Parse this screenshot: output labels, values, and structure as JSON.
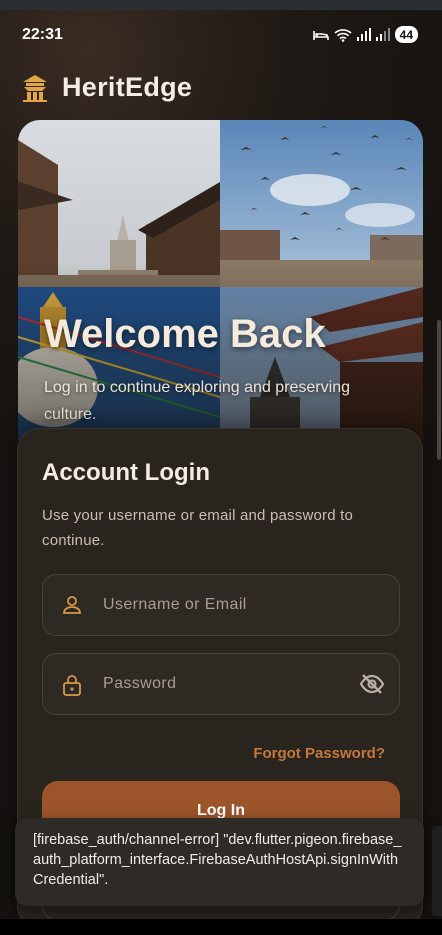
{
  "status_bar": {
    "time": "22:31",
    "battery": "44"
  },
  "brand": {
    "icon": "temple-icon",
    "name": "HeritEdge",
    "accent": "#e0a545"
  },
  "hero": {
    "title": "Welcome Back",
    "subtitle": "Log in to continue exploring and preserving culture."
  },
  "login_card": {
    "title": "Account Login",
    "subtitle": "Use your username or email and password to continue.",
    "username": {
      "placeholder": "Username or Email",
      "value": "",
      "icon": "person-icon"
    },
    "password": {
      "placeholder": "Password",
      "value": "",
      "icon": "lock-icon",
      "toggle_icon": "eye-off-icon"
    },
    "forgot_password_label": "Forgot Password?",
    "login_label": "Log In",
    "primary_color": "#9c552a",
    "link_color": "#c2783f"
  },
  "toast": {
    "message": "[firebase_auth/channel-error] \"dev.flutter.pigeon.firebase_auth_platform_interface.FirebaseAuthHostApi.signInWithCredential\"."
  }
}
